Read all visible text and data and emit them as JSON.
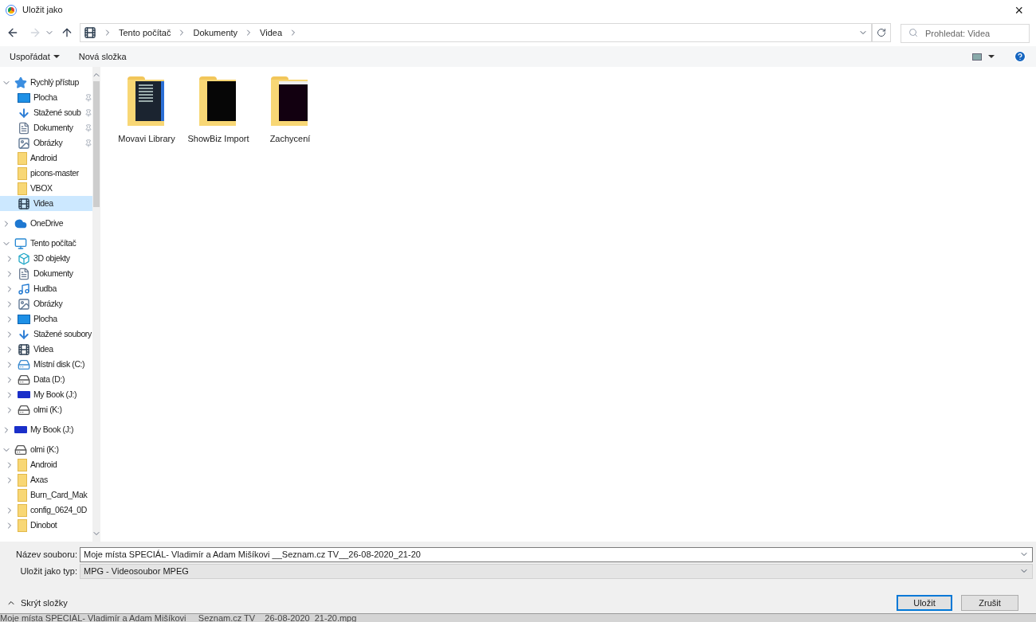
{
  "window": {
    "title": "Uložit jako",
    "close": "×"
  },
  "address": {
    "path": [
      "Tento počítač",
      "Dokumenty",
      "Videa"
    ],
    "search_placeholder": "Prohledat: Videa"
  },
  "toolbar": {
    "organize": "Uspořádat",
    "new_folder": "Nová složka"
  },
  "sidebar": {
    "items": [
      {
        "label": "Rychlý přístup",
        "kind": "star",
        "expanded": true,
        "selected": false,
        "children": [
          {
            "label": "Plocha",
            "kind": "desktop",
            "pinned": true,
            "selected": false
          },
          {
            "label": "Stažené soub",
            "kind": "download",
            "pinned": true,
            "selected": false
          },
          {
            "label": "Dokumenty",
            "kind": "document",
            "pinned": true,
            "selected": false
          },
          {
            "label": "Obrázky",
            "kind": "pictures",
            "pinned": true,
            "selected": false
          },
          {
            "label": "Android",
            "kind": "folder",
            "pinned": false,
            "selected": false
          },
          {
            "label": "picons-master",
            "kind": "folder",
            "pinned": false,
            "selected": false
          },
          {
            "label": "VBOX",
            "kind": "folder",
            "pinned": false,
            "selected": false
          },
          {
            "label": "Videa",
            "kind": "video",
            "pinned": false,
            "selected": true
          }
        ]
      },
      {
        "label": "OneDrive",
        "kind": "cloud",
        "expanded": false,
        "selected": false
      },
      {
        "label": "Tento počítač",
        "kind": "computer",
        "expanded": true,
        "selected": false,
        "children": [
          {
            "label": "3D objekty",
            "kind": "cube",
            "expanded": false,
            "selected": false
          },
          {
            "label": "Dokumenty",
            "kind": "document",
            "expanded": false,
            "selected": false
          },
          {
            "label": "Hudba",
            "kind": "music",
            "expanded": false,
            "selected": false
          },
          {
            "label": "Obrázky",
            "kind": "pictures",
            "expanded": false,
            "selected": false
          },
          {
            "label": "Plocha",
            "kind": "desktop",
            "expanded": false,
            "selected": false
          },
          {
            "label": "Stažené soubory",
            "kind": "download",
            "expanded": false,
            "selected": false
          },
          {
            "label": "Videa",
            "kind": "video",
            "expanded": false,
            "selected": false
          },
          {
            "label": "Místní disk (C:)",
            "kind": "system-drive",
            "expanded": false,
            "selected": false
          },
          {
            "label": "Data (D:)",
            "kind": "drive",
            "expanded": false,
            "selected": false
          },
          {
            "label": "My Book (J:)",
            "kind": "external-drive",
            "expanded": false,
            "selected": false
          },
          {
            "label": "olmi (K:)",
            "kind": "drive",
            "expanded": false,
            "selected": false
          }
        ]
      },
      {
        "label": "My Book (J:)",
        "kind": "external-drive",
        "expanded": false,
        "selected": false
      },
      {
        "label": "olmi (K:)",
        "kind": "drive",
        "expanded": true,
        "selected": false,
        "children": [
          {
            "label": "Android",
            "kind": "folder",
            "expanded": false,
            "selected": false
          },
          {
            "label": "Axas",
            "kind": "folder",
            "expanded": false,
            "selected": false
          },
          {
            "label": "Burn_Card_Mak",
            "kind": "folder",
            "selected": false
          },
          {
            "label": "config_0624_0D",
            "kind": "folder",
            "expanded": false,
            "selected": false
          },
          {
            "label": "Dinobot",
            "kind": "folder",
            "expanded": false,
            "selected": false
          }
        ]
      }
    ]
  },
  "files": [
    {
      "name": "Movavi Library",
      "kind": "menu"
    },
    {
      "name": "ShowBiz Import",
      "kind": "dark"
    },
    {
      "name": "Zachycení",
      "kind": "framed"
    }
  ],
  "form": {
    "filename_label": "Název souboru:",
    "filename": "Moje místa SPECIÁL- Vladimír a Adam Mišíkovi __Seznam.cz TV__26-08-2020_21-20",
    "type_label": "Uložit jako typ:",
    "type": "MPG - Videosoubor MPEG"
  },
  "footer": {
    "hide_folders": "Skrýt složky",
    "save": "Uložit",
    "cancel": "Zrušit"
  },
  "background_text": "Moje místa SPECIÁL- Vladimír a Adam Mišíkovi __Seznam.cz TV__26-08-2020_21-20.mpg"
}
